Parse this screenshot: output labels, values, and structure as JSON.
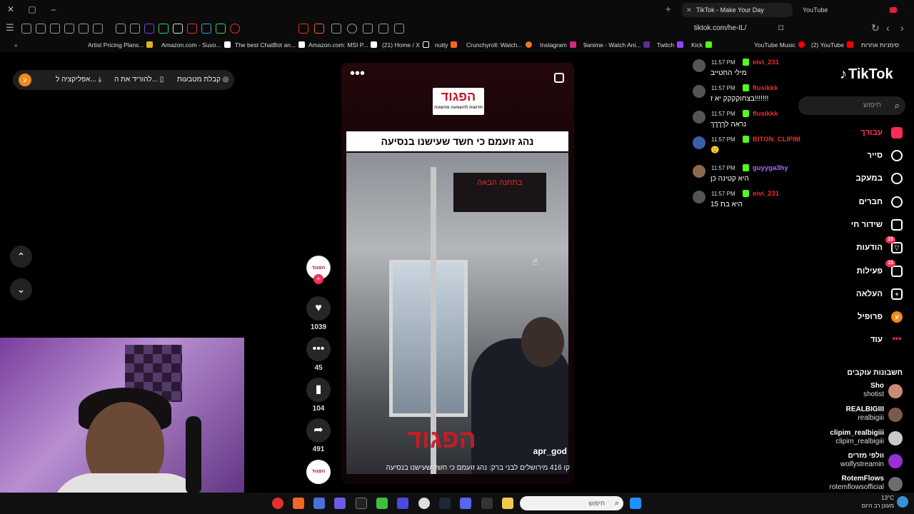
{
  "browser": {
    "active_tab": "TikTok - Make Your Day",
    "other_tab": "YouTube",
    "url": "tiktok.com/he-IL/"
  },
  "bookmarks": [
    {
      "label": "Artist Pricing Plans...",
      "color": "#e0b323"
    },
    {
      "label": "Amazon.com - Suvo...",
      "color": "#ffffff"
    },
    {
      "label": "The best ChatBot an...",
      "color": "#ffffff"
    },
    {
      "label": "Amazon.com: MSI P...",
      "color": "#ffffff"
    },
    {
      "label": "(21) Home / X",
      "color": "#ffffff"
    },
    {
      "label": "nutty",
      "color": "#f26522"
    },
    {
      "label": "Crunchyroll: Watch...",
      "color": "#f47521"
    },
    {
      "label": "Instagram",
      "color": "#d62976"
    },
    {
      "label": "9anime - Watch Ani...",
      "color": "#5a2d91"
    },
    {
      "label": "Twitch",
      "color": "#9146ff"
    },
    {
      "label": "Kick",
      "color": "#53fc18"
    },
    {
      "label": "YouTube Music",
      "color": "#ff0000"
    },
    {
      "label": "(2) YouTube",
      "color": "#ff0000"
    },
    {
      "label": "סימניות אחרות",
      "color": "#ffffff"
    }
  ],
  "appbar": {
    "avatar_letter": "ע",
    "open_app": "אפליקציה ל...",
    "download": "להוריד את ה...",
    "coins": "קבלת מטבעות"
  },
  "video": {
    "brand": "הפגוד",
    "brand_sub": "חדשות להשמעה מהשטח",
    "headline": "נהג זועמם כי חשד שעישנו בנסיעה",
    "sign": "בתחנה הבאה",
    "watermark": "הפגוד",
    "username": "apr_god",
    "caption": "קו 416 מירושלים לבני ברק: נהג זועמם כי חשד שעישנו בנסיעה"
  },
  "rail": {
    "avatar_text": "הפגוד",
    "likes": "1039",
    "comments": "45",
    "saves": "104",
    "shares": "491"
  },
  "chat": [
    {
      "time": "11:57 PM",
      "user": "eivi_231",
      "text": "מילי החטייב",
      "color": "#e8302a"
    },
    {
      "time": "11:57 PM",
      "user": "flusikkk",
      "text": "בצחוקקקק יא ז!!!!!!!",
      "color": "#e8302a"
    },
    {
      "time": "11:57 PM",
      "user": "flusikkk",
      "text": "נראה לךךךך",
      "color": "#e8302a"
    },
    {
      "time": "11:57 PM",
      "user": "BITON_CLIPIM",
      "text": "🙂",
      "color": "#e8302a"
    },
    {
      "time": "11:57 PM",
      "user": "guyyga3hy",
      "text": "היא קטינה כן",
      "color": "#a66cff"
    },
    {
      "time": "11:57 PM",
      "user": "eivi_231",
      "text": "היא בת 15",
      "color": "#e8302a"
    }
  ],
  "sidebar": {
    "logo": "TikTok",
    "search_placeholder": "חיפוש",
    "items": [
      {
        "label": "עבורך",
        "icon": "home-icon",
        "badge": ""
      },
      {
        "label": "סייר",
        "icon": "compass-icon",
        "badge": ""
      },
      {
        "label": "במעקב",
        "icon": "user-plus-icon",
        "badge": ""
      },
      {
        "label": "חברים",
        "icon": "friends-icon",
        "badge": ""
      },
      {
        "label": "שידור חי",
        "icon": "live-icon",
        "badge": ""
      },
      {
        "label": "הודעות",
        "icon": "send-icon",
        "badge": "15"
      },
      {
        "label": "פעילות",
        "icon": "inbox-icon",
        "badge": "15"
      },
      {
        "label": "העלאה",
        "icon": "upload-icon",
        "badge": ""
      },
      {
        "label": "פרופיל",
        "icon": "profile-icon",
        "badge": ""
      },
      {
        "label": "עוד",
        "icon": "more-icon",
        "badge": ""
      }
    ],
    "following_title": "חשבונות עוקבים",
    "following": [
      {
        "name": "Sho",
        "handle": "shotist"
      },
      {
        "name": "REALBIGIII",
        "handle": "realbigiii"
      },
      {
        "name": "clipim_realbigiii",
        "handle": "clipim_realbigiii"
      },
      {
        "name": "וולפי מזרים",
        "handle": "wolfystreamin"
      },
      {
        "name": "RotemFlows",
        "handle": "rotemflowsofficial"
      }
    ]
  },
  "taskbar": {
    "search_placeholder": "חיפוש",
    "temp": "13°C",
    "weather": "מעונן רב היום"
  },
  "colors": {
    "accent": "#fe2c55",
    "kick_green": "#53fc18"
  }
}
